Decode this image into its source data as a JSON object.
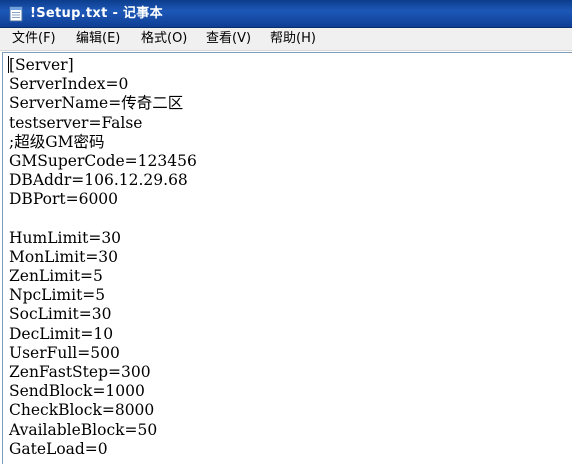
{
  "window": {
    "title": "!Setup.txt - 记事本",
    "icon": "notepad-icon"
  },
  "menu": {
    "file": "文件(F)",
    "edit": "编辑(E)",
    "format": "格式(O)",
    "view": "查看(V)",
    "help": "帮助(H)"
  },
  "document": {
    "lines": [
      "[Server]",
      "ServerIndex=0",
      "ServerName=传奇二区",
      "testserver=False",
      ";超级GM密码",
      "GMSuperCode=123456",
      "DBAddr=106.12.29.68",
      "DBPort=6000",
      "",
      "HumLimit=30",
      "MonLimit=30",
      "ZenLimit=5",
      "NpcLimit=5",
      "SocLimit=30",
      "DecLimit=10",
      "UserFull=500",
      "ZenFastStep=300",
      "SendBlock=1000",
      "CheckBlock=8000",
      "AvailableBlock=50",
      "GateLoad=0"
    ]
  },
  "colors": {
    "titlebar": "#1d58b8",
    "title_text": "#ffffff",
    "menubar": "#f0f0f0",
    "editor_background": "#ffffff",
    "text": "#000000"
  }
}
